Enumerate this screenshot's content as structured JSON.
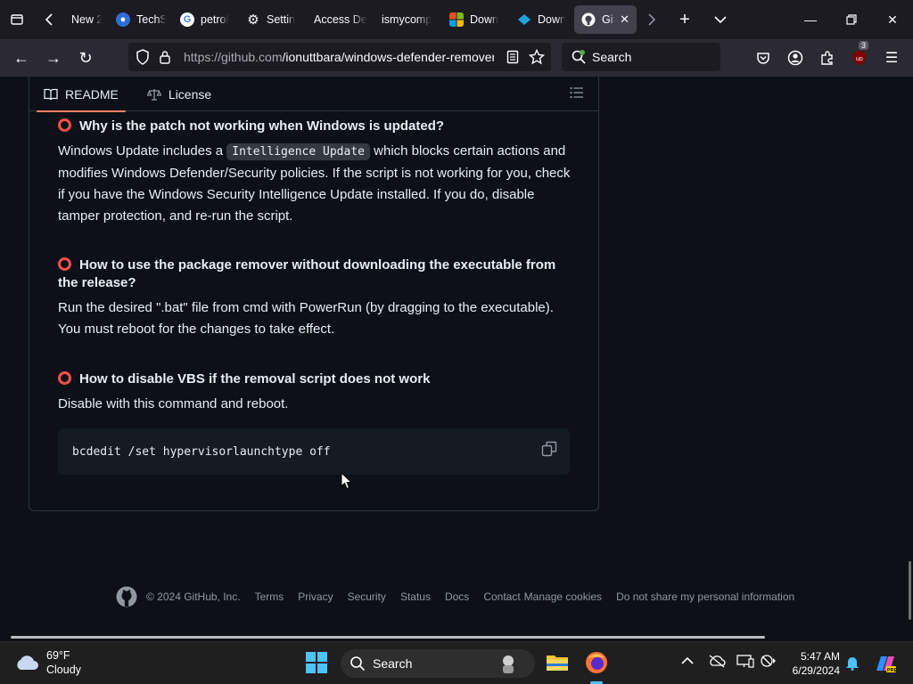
{
  "browser": {
    "tabs": [
      {
        "label": "New 2",
        "icon": "new-tab-icon"
      },
      {
        "label": "TechS",
        "icon": "techspot-icon"
      },
      {
        "label": "petrol",
        "icon": "google-icon"
      },
      {
        "label": "Settin",
        "icon": "gear-icon"
      },
      {
        "label": "Access De",
        "icon": ""
      },
      {
        "label": "ismycomp",
        "icon": ""
      },
      {
        "label": "Down",
        "icon": "microsoft-icon"
      },
      {
        "label": "Down",
        "icon": "download-site-icon"
      },
      {
        "label": "Git",
        "icon": "github-icon",
        "active": true
      }
    ],
    "url": "https://github.com/ionuttbara/windows-defender-remover",
    "url_host": "https://github.com",
    "url_path": "/ionuttbara/windows-defender-remover",
    "search_placeholder": "Search",
    "extension_badge": "3"
  },
  "readme": {
    "tabs": [
      {
        "label": "README",
        "icon": "book-icon",
        "selected": true
      },
      {
        "label": "License",
        "icon": "scale-icon",
        "selected": false
      }
    ],
    "sections": [
      {
        "heading": "Why is the patch not working when Windows is updated?",
        "text_before": "Windows Update includes a ",
        "inline_code": "Intelligence Update",
        "text_after": " which blocks certain actions and modifies Windows Defender/Security policies. If the script is not working for you, check if you have the Windows Security Intelligence Update installed. If you do, disable tamper protection, and re-run the script."
      },
      {
        "heading": "How to use the package remover without downloading the executable from the release?",
        "text": "Run the desired \".bat\" file from cmd with PowerRun (by dragging to the executable). You must reboot for the changes to take effect."
      },
      {
        "heading": "How to disable VBS if the removal script does not work",
        "text": "Disable with this command and reboot.",
        "code": "bcdedit /set hypervisorlaunchtype off"
      }
    ]
  },
  "footer": {
    "copyright": "© 2024 GitHub, Inc.",
    "links": [
      "Terms",
      "Privacy",
      "Security",
      "Status",
      "Docs",
      "Contact",
      "Manage cookies",
      "Do not share my personal information"
    ]
  },
  "taskbar": {
    "temperature": "69°F",
    "condition": "Cloudy",
    "search_label": "Search",
    "time": "5:47 AM",
    "date": "6/29/2024"
  },
  "colors": {
    "accent_underline": "#f78166",
    "ring": "#f85149",
    "page_bg": "#0d1117"
  }
}
